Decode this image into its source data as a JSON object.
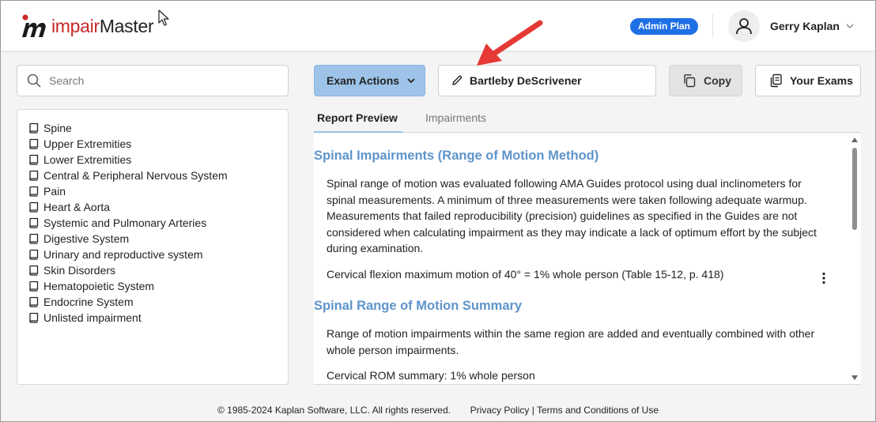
{
  "app": {
    "logo_prefix": "impair",
    "logo_suffix": "Master",
    "plan_badge": "Admin Plan",
    "user_name": "Gerry Kaplan"
  },
  "search": {
    "placeholder": "Search"
  },
  "sidebar": {
    "items": [
      {
        "label": "Spine"
      },
      {
        "label": "Upper Extremities"
      },
      {
        "label": "Lower Extremities"
      },
      {
        "label": "Central & Peripheral Nervous System"
      },
      {
        "label": "Pain"
      },
      {
        "label": "Heart & Aorta"
      },
      {
        "label": "Systemic and Pulmonary Arteries"
      },
      {
        "label": "Digestive System"
      },
      {
        "label": "Urinary and reproductive system"
      },
      {
        "label": "Skin Disorders"
      },
      {
        "label": "Hematopoietic System"
      },
      {
        "label": "Endocrine System"
      },
      {
        "label": "Unlisted impairment"
      }
    ]
  },
  "toolbar": {
    "exam_actions": "Exam Actions",
    "exam_name": "Bartleby DeScrivener",
    "copy": "Copy",
    "your_exams": "Your Exams"
  },
  "tabs": [
    {
      "label": "Report Preview"
    },
    {
      "label": "Impairments"
    }
  ],
  "report": {
    "section1_title": "Spinal Impairments (Range of Motion Method)",
    "section1_para1": "Spinal range of motion was evaluated following AMA Guides protocol using dual inclinometers for spinal measurements. A minimum of three measurements were taken following adequate warmup. Measurements that failed reproducibility (precision) guidelines as specified in the Guides are not considered when calculating impairment as they may indicate a lack of optimum effort by the subject during examination.",
    "section1_para2": "Cervical flexion maximum motion of 40° = 1% whole person (Table 15-12, p. 418)",
    "section2_title": "Spinal Range of Motion Summary",
    "section2_para1": "Range of motion impairments within the same region are added and eventually combined with other whole person impairments.",
    "section2_para2": "Cervical ROM summary: 1% whole person"
  },
  "footer": {
    "copyright": "© 1985-2024 Kaplan Software, LLC. All rights reserved.",
    "privacy": "Privacy Policy",
    "separator": "|",
    "terms": "Terms and Conditions of Use"
  },
  "colors": {
    "accent_blue": "#1f6fe5",
    "exam_button": "#9dc3e8",
    "heading_blue": "#5e94cb",
    "logo_red": "#c62828",
    "annotation_arrow": "#e53935"
  }
}
